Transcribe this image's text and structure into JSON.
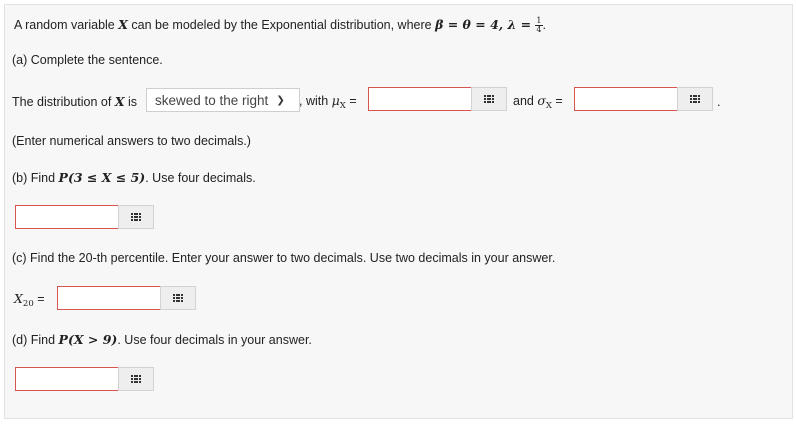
{
  "intro": {
    "text": "A random variable ",
    "var": "X",
    "text2": " can be modeled by the Exponential distribution, where ",
    "params": "β = θ = 4, λ = ",
    "frac_num": "1",
    "frac_den": "4",
    "period": "."
  },
  "part_a": {
    "heading": "(a) Complete the sentence.",
    "sentence_start": "The distribution of ",
    "var": "X",
    "is": " is",
    "dropdown_value": "skewed to the right",
    "with": ", with ",
    "mu": "μ",
    "sub_x": "X",
    "eq": " =",
    "and": "and ",
    "sigma": "σ",
    "period": ".",
    "note": "(Enter numerical answers to two decimals.)"
  },
  "part_b": {
    "heading_pre": "(b) Find ",
    "expr": "P(3 ≤ X ≤ 5)",
    "heading_post": ". Use four decimals."
  },
  "part_c": {
    "heading": "(c) Find the 20-th percentile. Enter your answer to two decimals. Use two decimals in your answer.",
    "label": "X",
    "label_sub": "20",
    "eq": " ="
  },
  "part_d": {
    "heading_pre": "(d) Find ",
    "expr": "P(X > 9)",
    "heading_post": ". Use four decimals in your answer."
  },
  "colors": {
    "error_border": "#d9534f",
    "panel_bg": "#f7f7f7"
  },
  "icons": {
    "keyboard": "keypad-grid-icon",
    "dropdown": "chevron-down-icon"
  }
}
